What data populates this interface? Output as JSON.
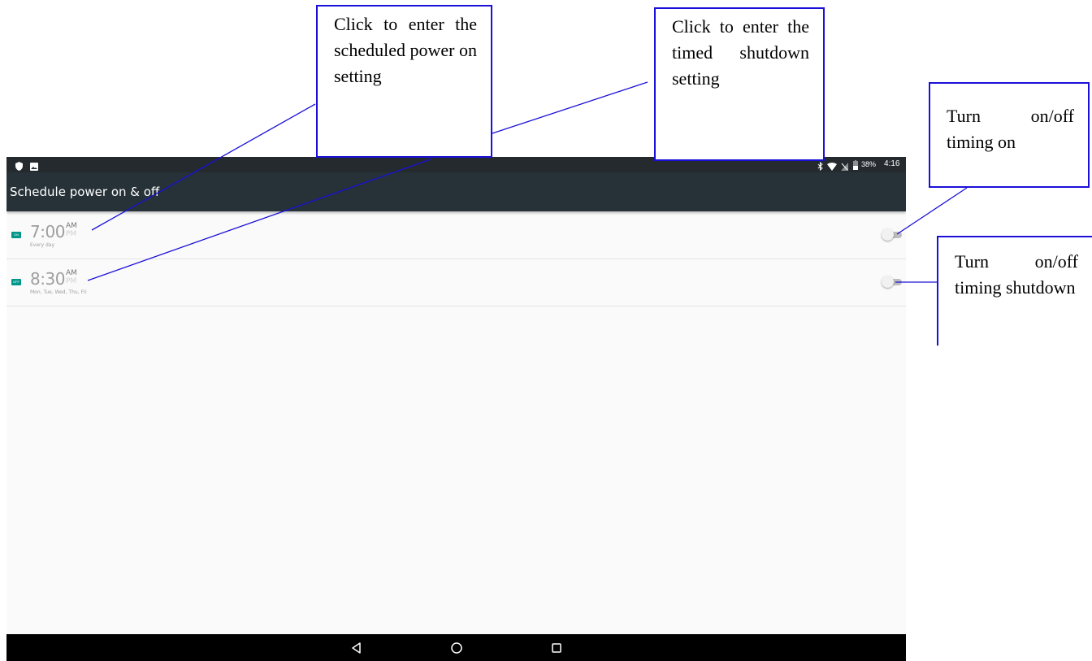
{
  "status_bar": {
    "left_icons": [
      "shield-icon",
      "image-icon"
    ],
    "battery": "38%",
    "clock": "4:16",
    "right_icons": [
      "bluetooth-icon",
      "wifi-icon",
      "no-sim-icon",
      "battery-icon"
    ]
  },
  "app_bar": {
    "title": "Schedule power on & off"
  },
  "schedules": [
    {
      "badge": "ON",
      "time": "7:00",
      "am": "AM",
      "pm": "PM",
      "days": "Every day",
      "enabled": false
    },
    {
      "badge": "OFF",
      "time": "8:30",
      "am": "AM",
      "pm": "PM",
      "days": "Mon, Tue, Wed, Thu, Fri",
      "enabled": false
    }
  ],
  "nav_bar": {
    "icons": [
      "back-icon",
      "home-icon",
      "recents-icon"
    ]
  },
  "callouts": {
    "power_on": "Click to enter the scheduled power on setting",
    "shutdown": "Click to enter the timed shutdown setting",
    "toggle_on": "Turn on/off timing on",
    "toggle_off": "Turn on/off timing shutdown"
  },
  "colors": {
    "accent": "#009688",
    "toolbar": "#263238",
    "status_bar": "#242a2e",
    "callout_border": "#1a10d8"
  }
}
